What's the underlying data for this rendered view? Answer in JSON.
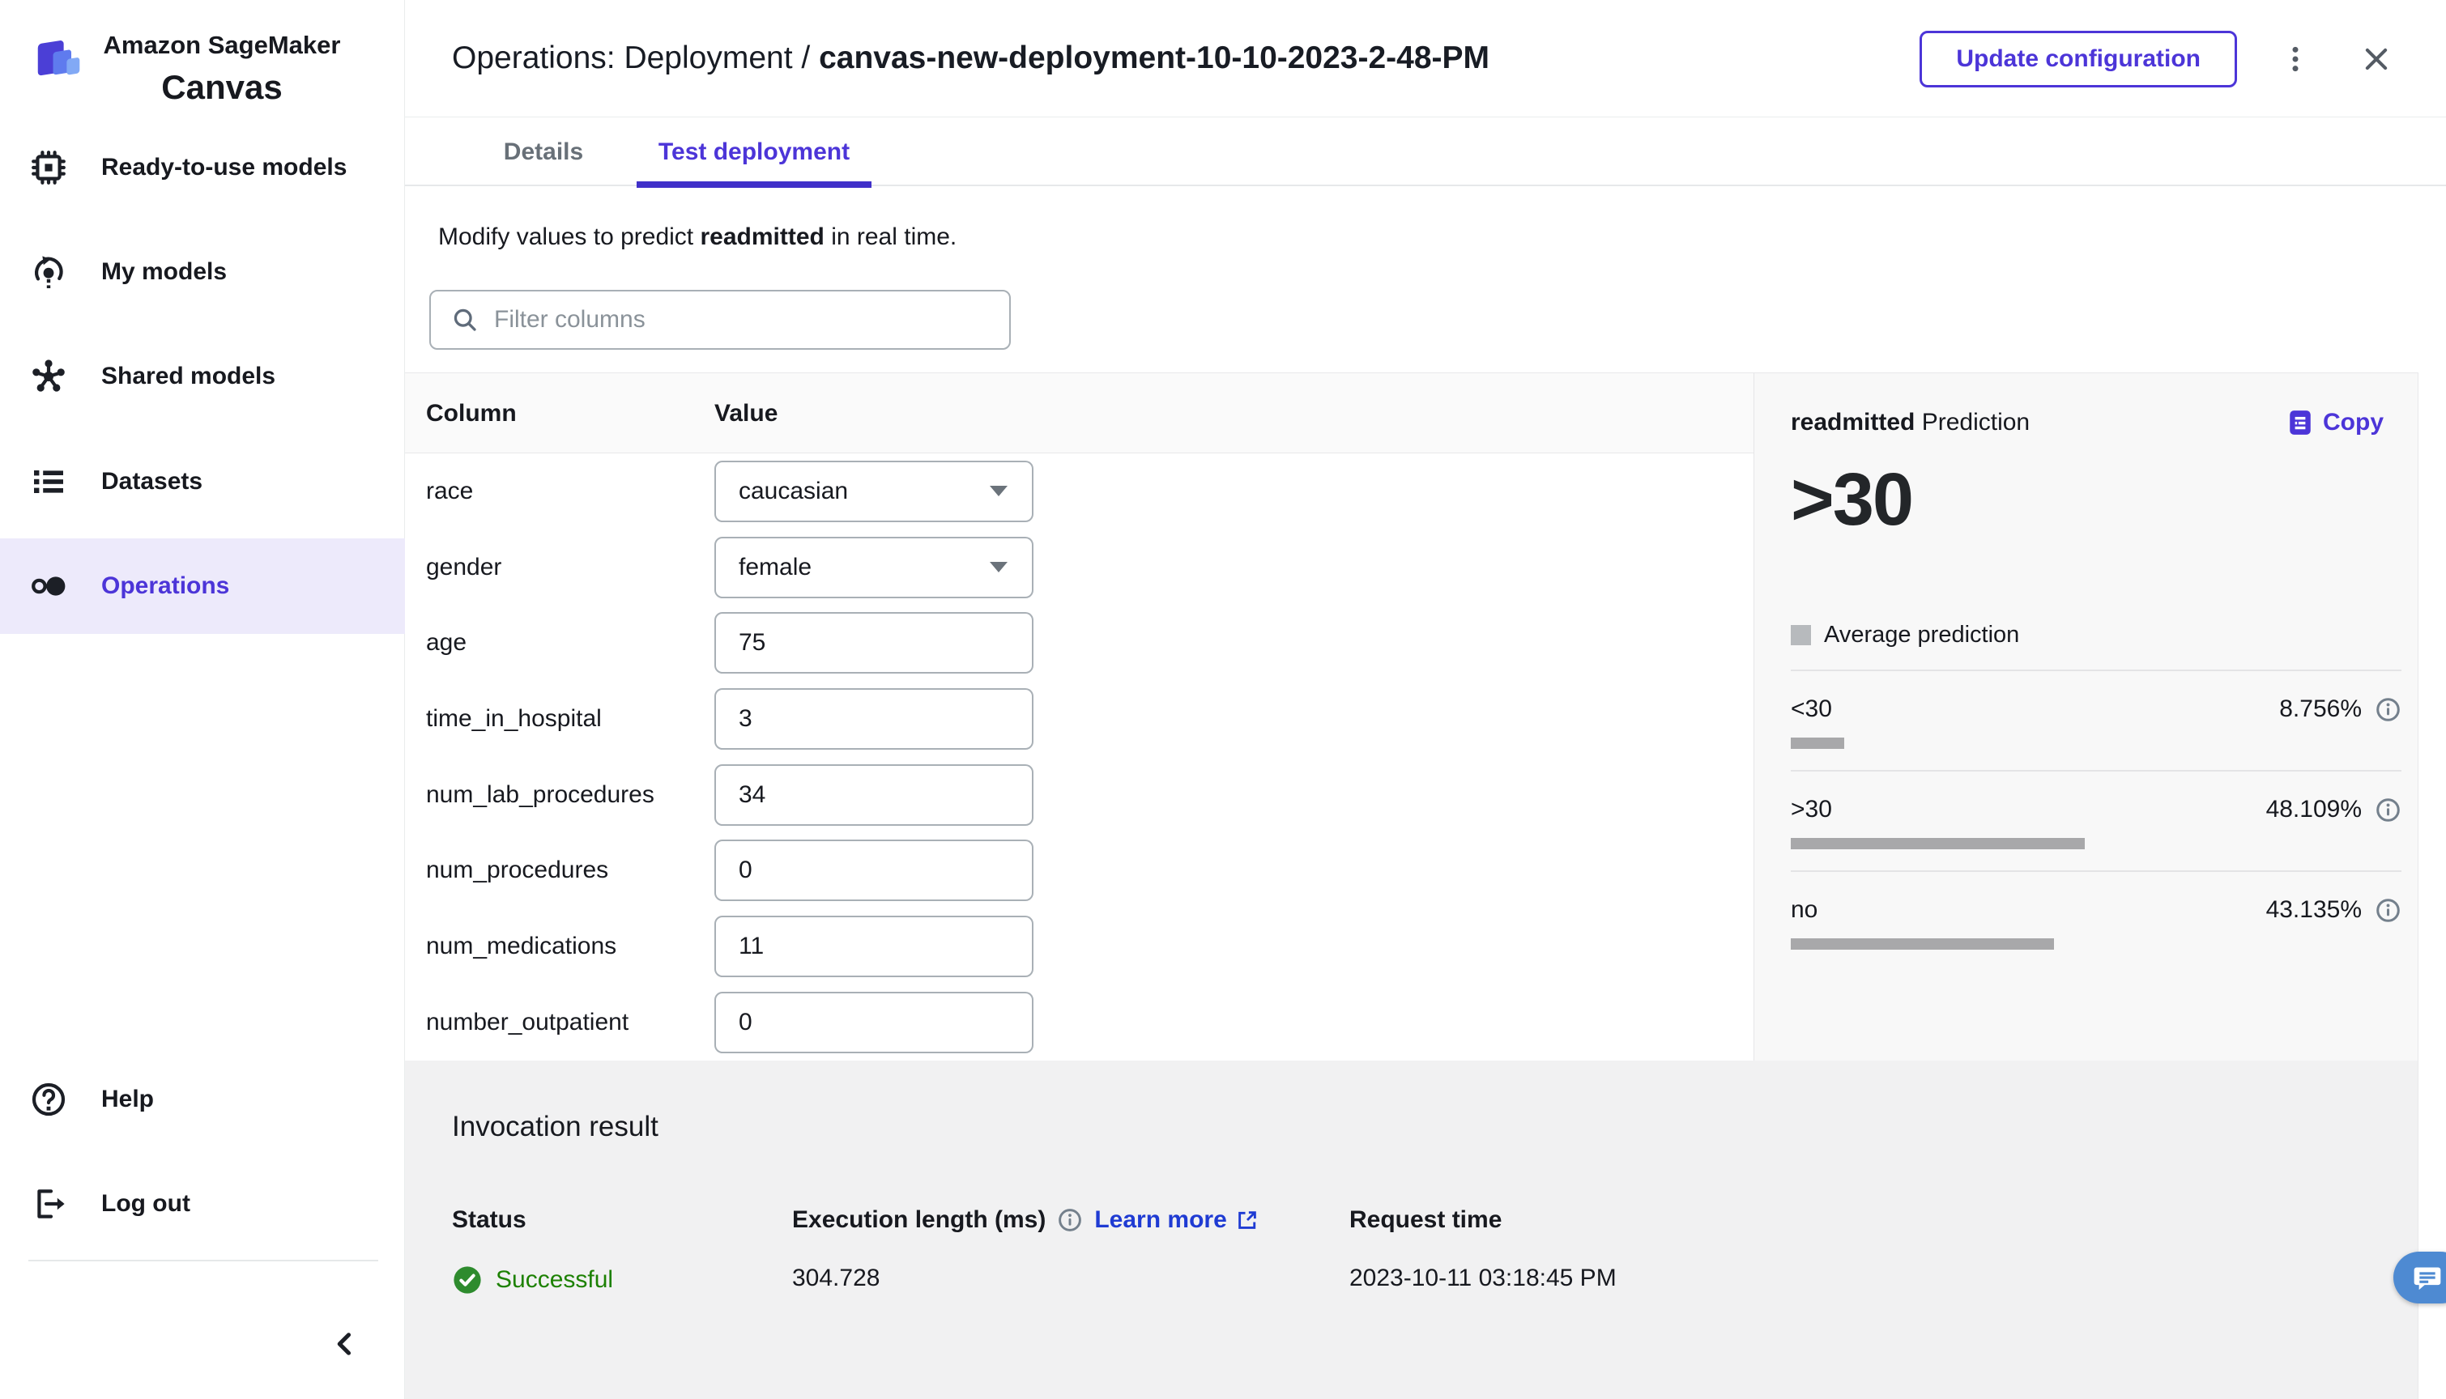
{
  "colors": {
    "accent_purple": "#4c35d8",
    "tab_underline": "#4030c9",
    "link_blue": "#1f3bd3",
    "success_green": "#1d8102",
    "bar_gray": "#a8a8aa",
    "active_item_bg": "#edeafb",
    "chat_blue": "#4e8ad2"
  },
  "brand": {
    "line1": "Amazon SageMaker",
    "line2": "Canvas"
  },
  "sidebar": {
    "items": [
      {
        "label": "Ready-to-use models",
        "icon": "chip-icon"
      },
      {
        "label": "My models",
        "icon": "model-refresh-icon"
      },
      {
        "label": "Shared models",
        "icon": "network-icon"
      },
      {
        "label": "Datasets",
        "icon": "list-icon"
      },
      {
        "label": "Operations",
        "icon": "two-circles-icon",
        "active": true
      }
    ],
    "footer": [
      {
        "label": "Help",
        "icon": "question-circle-icon"
      },
      {
        "label": "Log out",
        "icon": "logout-icon"
      }
    ]
  },
  "header": {
    "title_prefix": "Operations: Deployment / ",
    "title_name": "canvas-new-deployment-10-10-2023-2-48-PM",
    "update_button": "Update configuration"
  },
  "tabs": [
    {
      "label": "Details",
      "active": false
    },
    {
      "label": "Test deployment",
      "active": true
    }
  ],
  "test": {
    "intro_prefix": "Modify values to predict ",
    "intro_target": "readmitted",
    "intro_suffix": " in real time.",
    "filter_placeholder": "Filter columns"
  },
  "table": {
    "col_header": "Column",
    "value_header": "Value",
    "rows": [
      {
        "name": "race",
        "value": "caucasian",
        "control": "select"
      },
      {
        "name": "gender",
        "value": "female",
        "control": "select"
      },
      {
        "name": "age",
        "value": "75",
        "control": "input"
      },
      {
        "name": "time_in_hospital",
        "value": "3",
        "control": "input"
      },
      {
        "name": "num_lab_procedures",
        "value": "34",
        "control": "input"
      },
      {
        "name": "num_procedures",
        "value": "0",
        "control": "input"
      },
      {
        "name": "num_medications",
        "value": "11",
        "control": "input"
      },
      {
        "name": "number_outpatient",
        "value": "0",
        "control": "input"
      }
    ]
  },
  "prediction": {
    "target": "readmitted",
    "heading_suffix": " Prediction",
    "copy_label": "Copy",
    "value": ">30",
    "legend_label": "Average prediction",
    "probabilities": [
      {
        "label": "<30",
        "display": "8.756%",
        "pct": 8.756
      },
      {
        "label": ">30",
        "display": "48.109%",
        "pct": 48.109
      },
      {
        "label": "no",
        "display": "43.135%",
        "pct": 43.135
      }
    ]
  },
  "invocation": {
    "title": "Invocation result",
    "status_label": "Status",
    "status_value": "Successful",
    "execution_label": "Execution length (ms)",
    "learn_more_label": "Learn more",
    "execution_value": "304.728",
    "request_label": "Request time",
    "request_value": "2023-10-11 03:18:45 PM"
  }
}
